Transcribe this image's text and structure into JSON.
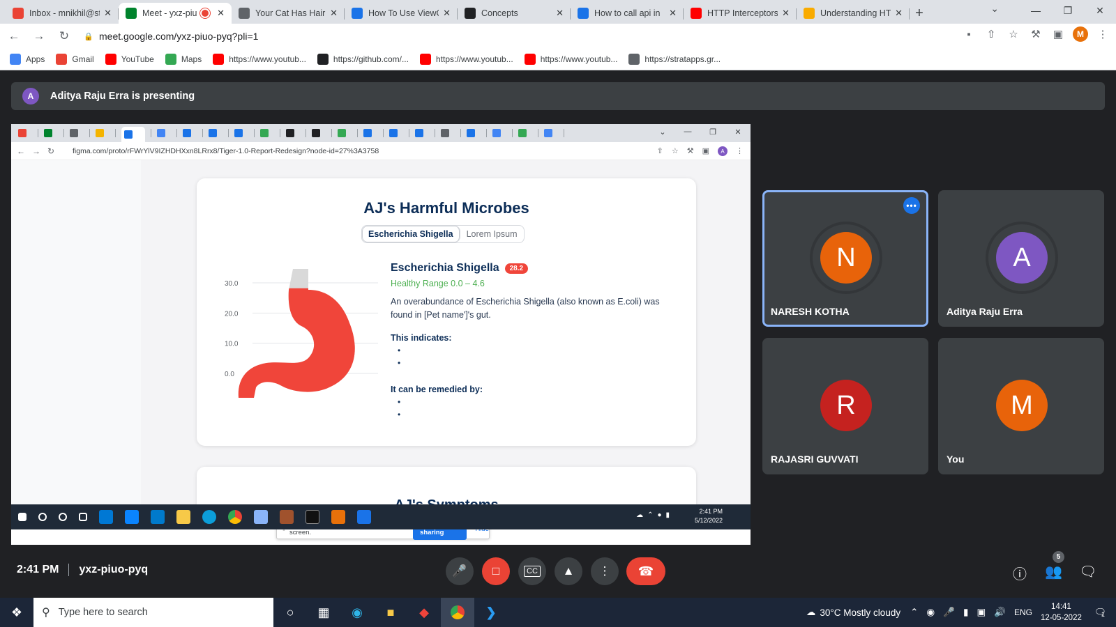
{
  "browser": {
    "tabs": [
      {
        "title": "Inbox - mnikhil@st",
        "favicon": "gmail-icon",
        "color": "#ea4335"
      },
      {
        "title": "Meet - yxz-piu",
        "favicon": "meet-icon",
        "color": "#00832d",
        "active": true,
        "recording": true
      },
      {
        "title": "Your Cat Has Hairb",
        "favicon": "web-icon",
        "color": "#5f6368"
      },
      {
        "title": "How To Use ViewC",
        "favicon": "web-icon",
        "color": "#1a73e8"
      },
      {
        "title": "Concepts",
        "favicon": "angular-icon",
        "color": "#202124"
      },
      {
        "title": "How to call api in",
        "favicon": "web-icon",
        "color": "#1a73e8"
      },
      {
        "title": "HTTP Interceptors",
        "favicon": "youtube-icon",
        "color": "#ff0000"
      },
      {
        "title": "Understanding HT",
        "favicon": "tek-icon",
        "color": "#f9ab00"
      }
    ],
    "url": "meet.google.com/yxz-piuo-pyq?pli=1",
    "profile_initial": "M",
    "bookmarks": [
      {
        "label": "Apps",
        "icon": "apps-grid-icon",
        "color": "#4285f4"
      },
      {
        "label": "Gmail",
        "icon": "gmail-icon",
        "color": "#ea4335"
      },
      {
        "label": "YouTube",
        "icon": "youtube-icon",
        "color": "#ff0000"
      },
      {
        "label": "Maps",
        "icon": "maps-icon",
        "color": "#34a853"
      },
      {
        "label": "https://www.youtub...",
        "icon": "youtube-icon",
        "color": "#ff0000"
      },
      {
        "label": "https://github.com/...",
        "icon": "github-icon",
        "color": "#202124"
      },
      {
        "label": "https://www.youtub...",
        "icon": "youtube-icon",
        "color": "#ff0000"
      },
      {
        "label": "https://www.youtub...",
        "icon": "youtube-icon",
        "color": "#ff0000"
      },
      {
        "label": "https://stratapps.gr...",
        "icon": "strat-icon",
        "color": "#5f6368"
      }
    ]
  },
  "meet": {
    "presenter_initial": "A",
    "presenting_text": "Aditya Raju Erra is presenting",
    "time": "2:41 PM",
    "meeting_code": "yxz-piuo-pyq",
    "participant_count": "5",
    "participants": [
      {
        "name": "NARESH KOTHA",
        "initial": "N",
        "color": "#e8630a",
        "speaking": true
      },
      {
        "name": "Aditya Raju Erra",
        "initial": "A",
        "color": "#7e57c2"
      },
      {
        "name": "RAJASRI GUVVATI",
        "initial": "R",
        "color": "#c5221f"
      },
      {
        "name": "You",
        "initial": "M",
        "color": "#e8630a"
      }
    ]
  },
  "shared_screen": {
    "url": "figma.com/proto/rFWrYlV9IZHDHXxn8LRrx8/Tiger-1.0-Report-Redesign?node-id=27%3A3758",
    "profile_initial": "A",
    "card_title": "AJ's Harmful Microbes",
    "pills": [
      "Escherichia Shigella",
      "Lorem Ipsum"
    ],
    "microbe_name": "Escherichia Shigella",
    "badge_value": "28.2",
    "healthy_range": "Healthy Range 0.0 – 4.6",
    "description": "An overabundance of Escherichia Shigella (also known as E.coli) was found in [Pet name']'s gut.",
    "indicates_label": "This indicates:",
    "remedied_label": "It can be remedied by:",
    "bullet": "•",
    "next_card_title": "AJ's Symptoms",
    "share_banner_text": "meet.google.com is sharing your screen.",
    "stop_sharing": "Stop sharing",
    "hide": "Hide",
    "clock_time": "2:41 PM",
    "clock_date": "5/12/2022",
    "accent_red": "#f0453a",
    "healthy_green": "#4caf50"
  },
  "chart_data": {
    "type": "area",
    "yticks": [
      "30.0",
      "20.0",
      "10.0",
      "0.0"
    ],
    "ylim": [
      0,
      30
    ],
    "value": 28.2,
    "fill_color": "#f0453a"
  },
  "taskbar": {
    "search_placeholder": "Type here to search",
    "weather": "30°C  Mostly cloudy",
    "language": "ENG",
    "time": "14:41",
    "date": "12-05-2022",
    "notifications": "1"
  }
}
